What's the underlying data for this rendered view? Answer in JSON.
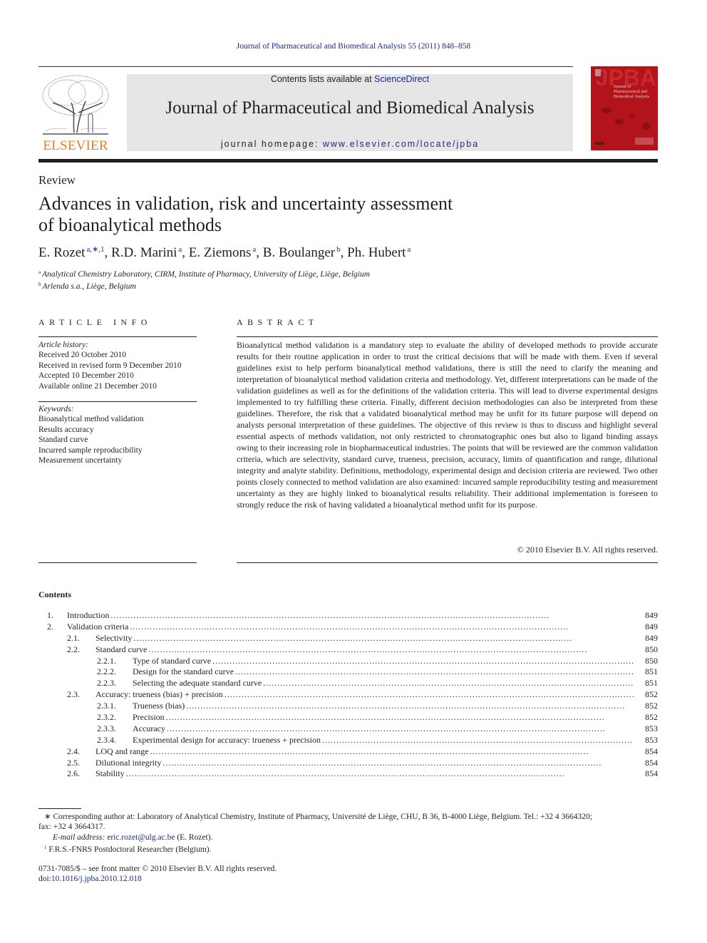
{
  "header": {
    "citation": "Journal of Pharmaceutical and Biomedical Analysis 55 (2011) 848–858",
    "contents_prefix": "Contents lists available at ",
    "contents_link": "ScienceDirect",
    "journal_name": "Journal of Pharmaceutical and Biomedical Analysis",
    "homepage_prefix": "journal homepage: ",
    "homepage_link": "www.elsevier.com/locate/jpba",
    "publisher_logo_text": "ELSEVIER",
    "cover_title": "JPBA",
    "cover_subtitle": "Journal of Pharmaceutical and Biomedical Analysis",
    "colors": {
      "link": "#1b2a8a",
      "publisher_orange": "#ed7d1a",
      "cover_red": "#b3141c",
      "masthead_gray": "#e6e6e6"
    }
  },
  "article": {
    "type": "Review",
    "title_line1": "Advances in validation, risk and uncertainty assessment",
    "title_line2": "of bioanalytical methods",
    "authors": [
      {
        "name": "E. Rozet",
        "marks": "a,∗,1",
        "sep": ", "
      },
      {
        "name": "R.D. Marini",
        "marks": "a",
        "sep": ", "
      },
      {
        "name": "E. Ziemons",
        "marks": "a",
        "sep": ", "
      },
      {
        "name": "B. Boulanger",
        "marks": "b",
        "sep": ", "
      },
      {
        "name": "Ph. Hubert",
        "marks": "a",
        "sep": ""
      }
    ],
    "affiliations": [
      {
        "mark": "a",
        "text": "Analytical Chemistry Laboratory, CIRM, Institute of Pharmacy, University of Liège, Liège, Belgium"
      },
      {
        "mark": "b",
        "text": "Arlenda s.a., Liège, Belgium"
      }
    ]
  },
  "article_info": {
    "heading": "ARTICLE INFO",
    "history_label": "Article history:",
    "history": [
      "Received 20 October 2010",
      "Received in revised form 9 December 2010",
      "Accepted 10 December 2010",
      "Available online 21 December 2010"
    ],
    "keywords_label": "Keywords:",
    "keywords": [
      "Bioanalytical method validation",
      "Results accuracy",
      "Standard curve",
      "Incurred sample reproducibility",
      "Measurement uncertainty"
    ]
  },
  "abstract": {
    "heading": "ABSTRACT",
    "text": "Bioanalytical method validation is a mandatory step to evaluate the ability of developed methods to provide accurate results for their routine application in order to trust the critical decisions that will be made with them. Even if several guidelines exist to help perform bioanalytical method validations, there is still the need to clarify the meaning and interpretation of bioanalytical method validation criteria and methodology. Yet, different interpretations can be made of the validation guidelines as well as for the definitions of the validation criteria. This will lead to diverse experimental designs implemented to try fulfilling these criteria. Finally, different decision methodologies can also be interpreted from these guidelines. Therefore, the risk that a validated bioanalytical method may be unfit for its future purpose will depend on analysts personal interpretation of these guidelines. The objective of this review is thus to discuss and highlight several essential aspects of methods validation, not only restricted to chromatographic ones but also to ligand binding assays owing to their increasing role in biopharmaceutical industries. The points that will be reviewed are the common validation criteria, which are selectivity, standard curve, trueness, precision, accuracy, limits of quantification and range, dilutional integrity and analyte stability. Definitions, methodology, experimental design and decision criteria are reviewed. Two other points closely connected to method validation are also examined: incurred sample reproducibility testing and measurement uncertainty as they are highly linked to bioanalytical results reliability. Their additional implementation is foreseen to strongly reduce the risk of having validated a bioanalytical method unfit for its purpose.",
    "copyright": "© 2010 Elsevier B.V. All rights reserved."
  },
  "contents": {
    "heading": "Contents",
    "entries": [
      {
        "level": 1,
        "num": "1.",
        "title": "Introduction",
        "page": "849"
      },
      {
        "level": 1,
        "num": "2.",
        "title": "Validation criteria",
        "page": "849"
      },
      {
        "level": 2,
        "num": "2.1.",
        "title": "Selectivity",
        "page": "849"
      },
      {
        "level": 2,
        "num": "2.2.",
        "title": "Standard curve",
        "page": "850"
      },
      {
        "level": 3,
        "num": "2.2.1.",
        "title": "Type of standard curve",
        "page": "850"
      },
      {
        "level": 3,
        "num": "2.2.2.",
        "title": "Design for the standard curve",
        "page": "851"
      },
      {
        "level": 3,
        "num": "2.2.3.",
        "title": "Selecting the adequate standard curve",
        "page": "851"
      },
      {
        "level": 2,
        "num": "2.3.",
        "title": "Accuracy: trueness (bias) + precision",
        "page": "852"
      },
      {
        "level": 3,
        "num": "2.3.1.",
        "title": "Trueness (bias)",
        "page": "852"
      },
      {
        "level": 3,
        "num": "2.3.2.",
        "title": "Precision",
        "page": "852"
      },
      {
        "level": 3,
        "num": "2.3.3.",
        "title": "Accuracy",
        "page": "853"
      },
      {
        "level": 3,
        "num": "2.3.4.",
        "title": "Experimental design for accuracy: trueness + precision",
        "page": "853"
      },
      {
        "level": 2,
        "num": "2.4.",
        "title": "LOQ and range",
        "page": "854"
      },
      {
        "level": 2,
        "num": "2.5.",
        "title": "Dilutional integrity",
        "page": "854"
      },
      {
        "level": 2,
        "num": "2.6.",
        "title": "Stability",
        "page": "854"
      }
    ]
  },
  "footnotes": {
    "corresponding_mark": "∗",
    "corresponding": "Corresponding author at: Laboratory of Analytical Chemistry, Institute of Pharmacy, Université de Liège, CHU, B 36, B-4000 Liège, Belgium. Tel.: +32 4 3664320;",
    "fax": "fax: +32 4 3664317.",
    "email_label": "E-mail address: ",
    "email": "eric.rozet@ulg.ac.be",
    "email_suffix": " (E. Rozet).",
    "note1_mark": "1",
    "note1": "F.R.S.-FNRS Postdoctoral Researcher (Belgium).",
    "front_matter": "0731-7085/$ – see front matter © 2010 Elsevier B.V. All rights reserved.",
    "doi_prefix": "doi:",
    "doi": "10.1016/j.jpba.2010.12.018"
  }
}
